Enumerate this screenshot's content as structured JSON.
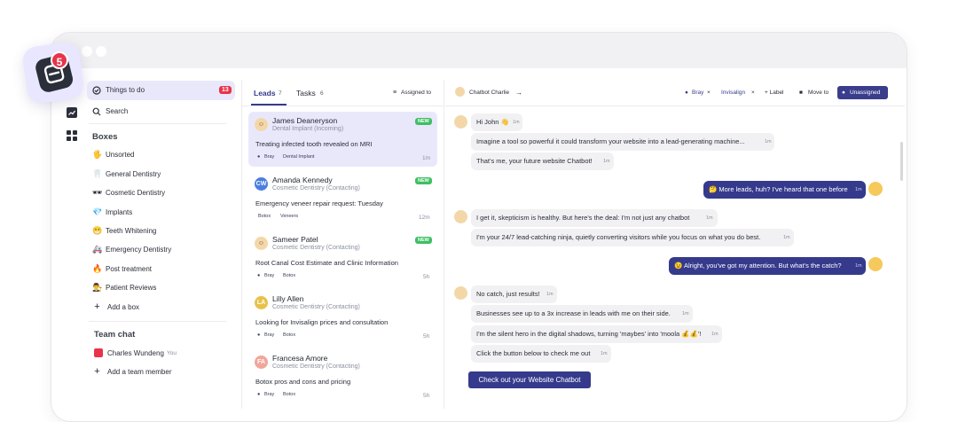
{
  "app": {
    "notification_count": "5",
    "accent_color": "#353a8c",
    "alert_color": "#e8334a"
  },
  "sidebar": {
    "things_to_do": {
      "label": "Things to do",
      "count": "13"
    },
    "search": {
      "label": "Search"
    },
    "boxes_title": "Boxes",
    "boxes": [
      {
        "icon": "hand-icon",
        "glyph": "🖐",
        "label": "Unsorted"
      },
      {
        "icon": "tooth-icon",
        "glyph": "🦷",
        "label": "General Dentistry"
      },
      {
        "icon": "sunglasses-icon",
        "glyph": "🕶",
        "label": "Cosmetic Dentistry"
      },
      {
        "icon": "diamond-icon",
        "glyph": "💎",
        "label": "Implants"
      },
      {
        "icon": "grin-icon",
        "glyph": "😁",
        "label": "Teeth Whitening"
      },
      {
        "icon": "ambulance-icon",
        "glyph": "🚑",
        "label": "Emergency Dentistry"
      },
      {
        "icon": "fire-icon",
        "glyph": "🔥",
        "label": "Post treatment"
      },
      {
        "icon": "judge-icon",
        "glyph": "👨‍⚖️",
        "label": "Patient Reviews"
      }
    ],
    "add_box": "Add a box",
    "team_chat_title": "Team chat",
    "team_member": {
      "name": "Charles Wundeng",
      "you_label": "You"
    },
    "add_member": "Add a team member"
  },
  "leads_panel": {
    "tabs": [
      {
        "label": "Leads",
        "count": "7"
      },
      {
        "label": "Tasks",
        "count": "6"
      }
    ],
    "filter_label": "Assigned to",
    "leads": [
      {
        "name": "James Deaneryson",
        "stage": "Dental Implant (Incoming)",
        "message": "Treating infected tooth revealed on MRI",
        "badge": "NEW",
        "tags": [
          "Bray",
          "Dental Implant"
        ],
        "time": "1m",
        "initials": "",
        "avatar_color": "#f4d7a8"
      },
      {
        "name": "Amanda Kennedy",
        "stage": "Cosmetic Dentistry (Contacting)",
        "message": "Emergency veneer repair request: Tuesday",
        "badge": "NEW",
        "tags": [
          "Botox",
          "Veneers"
        ],
        "time": "12m",
        "initials": "CW",
        "avatar_color": "#4a7fe0"
      },
      {
        "name": "Sameer Patel",
        "stage": "Cosmetic Dentistry (Contacting)",
        "message": "Root Canal Cost Estimate and Clinic Information",
        "badge": "NEW",
        "tags": [
          "Bray",
          "Botox"
        ],
        "time": "5h",
        "initials": "",
        "avatar_color": "#f4d7a8"
      },
      {
        "name": "Lilly Allen",
        "stage": "Cosmetic Dentistry (Contacting)",
        "message": "Looking for Invisalign prices and consultation",
        "badge": "",
        "tags": [
          "Bray",
          "Botox"
        ],
        "time": "5h",
        "initials": "LA",
        "avatar_color": "#e7c24a"
      },
      {
        "name": "Francesa Amore",
        "stage": "Cosmetic Dentistry (Contacting)",
        "message": "Botox pros and cons and pricing",
        "badge": "",
        "tags": [
          "Bray",
          "Botox"
        ],
        "time": "5h",
        "initials": "FA",
        "avatar_color": "#f1a69a"
      }
    ]
  },
  "chat_header": {
    "contact": "Chatbot Charlie",
    "tags": [
      "Bray",
      "Invisalign"
    ],
    "label_btn": "+ Label",
    "move_btn": "Move to",
    "assign_btn": "Unassigned"
  },
  "chat": {
    "messages": [
      {
        "from": "bot",
        "text": "Hi John 👋",
        "time": "1m"
      },
      {
        "from": "bot",
        "text": "Imagine a tool so powerful it could transform your website into a lead-generating machine...",
        "time": "1m"
      },
      {
        "from": "bot",
        "text": "That's me, your future website Chatbot!",
        "time": "1m"
      },
      {
        "from": "user",
        "text": "🤔 More leads, huh? I've heard that one before",
        "time": "1m"
      },
      {
        "from": "bot",
        "text": "I get it, skepticism is healthy. But here's the deal: I'm not just any chatbot",
        "time": "1m"
      },
      {
        "from": "bot",
        "text": "I'm your 24/7 lead-catching ninja, quietly converting visitors while you focus on what you do best.",
        "time": "1m"
      },
      {
        "from": "user",
        "text": "😉 Alright, you've got my attention. But what's the catch?",
        "time": "1m"
      },
      {
        "from": "bot",
        "text": "No catch, just results!",
        "time": "1m"
      },
      {
        "from": "bot",
        "text": "Businesses see up to a 3x increase in leads with me on their side.",
        "time": "1m"
      },
      {
        "from": "bot",
        "text": "I'm the silent hero in the digital shadows, turning 'maybes' into 'moola 💰💰'!",
        "time": "1m"
      },
      {
        "from": "bot",
        "text": "Click the button below to check me out",
        "time": "1m"
      }
    ],
    "cta": "Check out your Website Chatbot"
  }
}
